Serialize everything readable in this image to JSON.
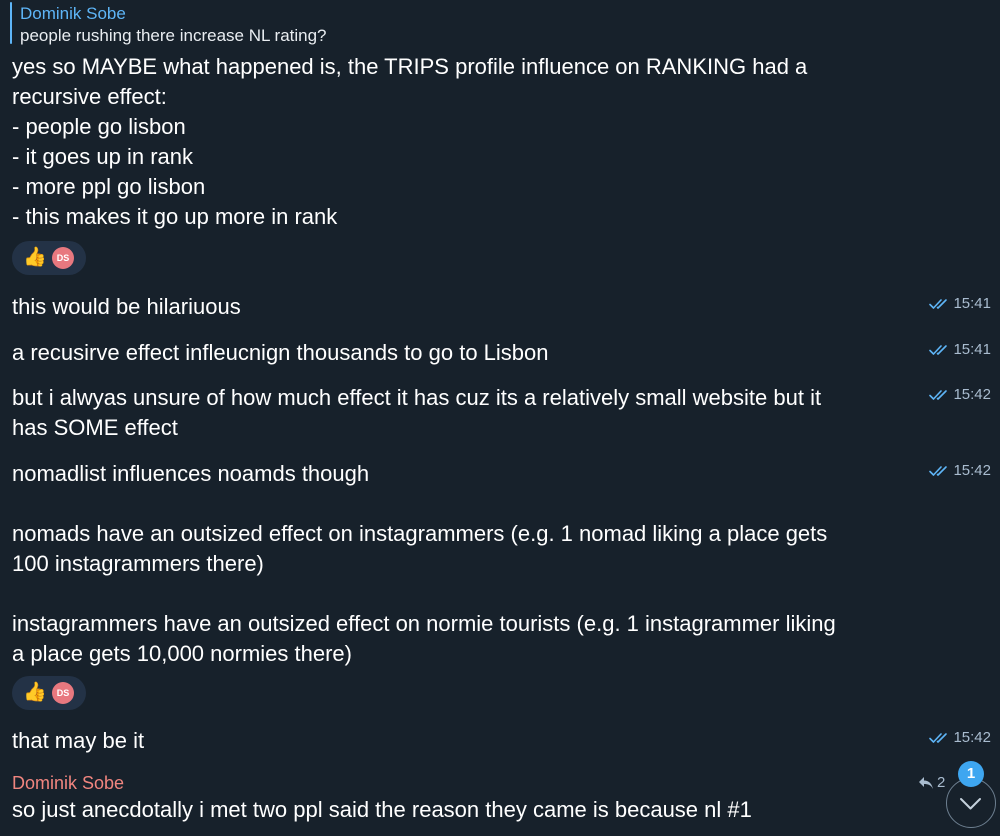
{
  "reply": {
    "author": "Dominik Sobe",
    "text": "people rushing there increase NL rating?"
  },
  "messages": [
    {
      "text": "yes so MAYBE what happened is, the TRIPS profile influence on RANKING had a\nrecursive effect:\n- people go lisbon\n- it goes up in rank\n- more ppl go lisbon\n- this makes it go up more in rank",
      "reaction": {
        "emoji": "👍",
        "avatar_initials": "DS"
      }
    },
    {
      "text": "this would be hilariuous",
      "time": "15:41"
    },
    {
      "text": "a recusirve effect infleucnign thousands to go to Lisbon",
      "time": "15:41"
    },
    {
      "text": "but i alwyas unsure of how much effect it has cuz its a relatively small website but it\nhas SOME effect",
      "time": "15:42"
    },
    {
      "text": "nomadlist influences noamds though\n\nnomads have an outsized effect on instagrammers (e.g. 1 nomad liking a place gets\n100 instagrammers there)\n\ninstagrammers have an outsized effect on normie tourists (e.g. 1 instagrammer liking\na place gets 10,000 normies there)",
      "time": "15:42",
      "reaction": {
        "emoji": "👍",
        "avatar_initials": "DS"
      }
    },
    {
      "text": "that may be it",
      "time": "15:42"
    }
  ],
  "incoming": {
    "sender": "Dominik Sobe",
    "text": "so just anecdotally i met two ppl said the reason they came is because nl #1",
    "reply_count": "2",
    "reply_icon": "reply-arrow-icon"
  },
  "scroll": {
    "unread_count": "1",
    "icon": "chevron-down-icon"
  },
  "colors": {
    "background": "#17212b",
    "accent": "#5eb5f7",
    "sender_name": "#f0857f",
    "meta": "#a9bccf",
    "badge": "#3ea6f0"
  }
}
